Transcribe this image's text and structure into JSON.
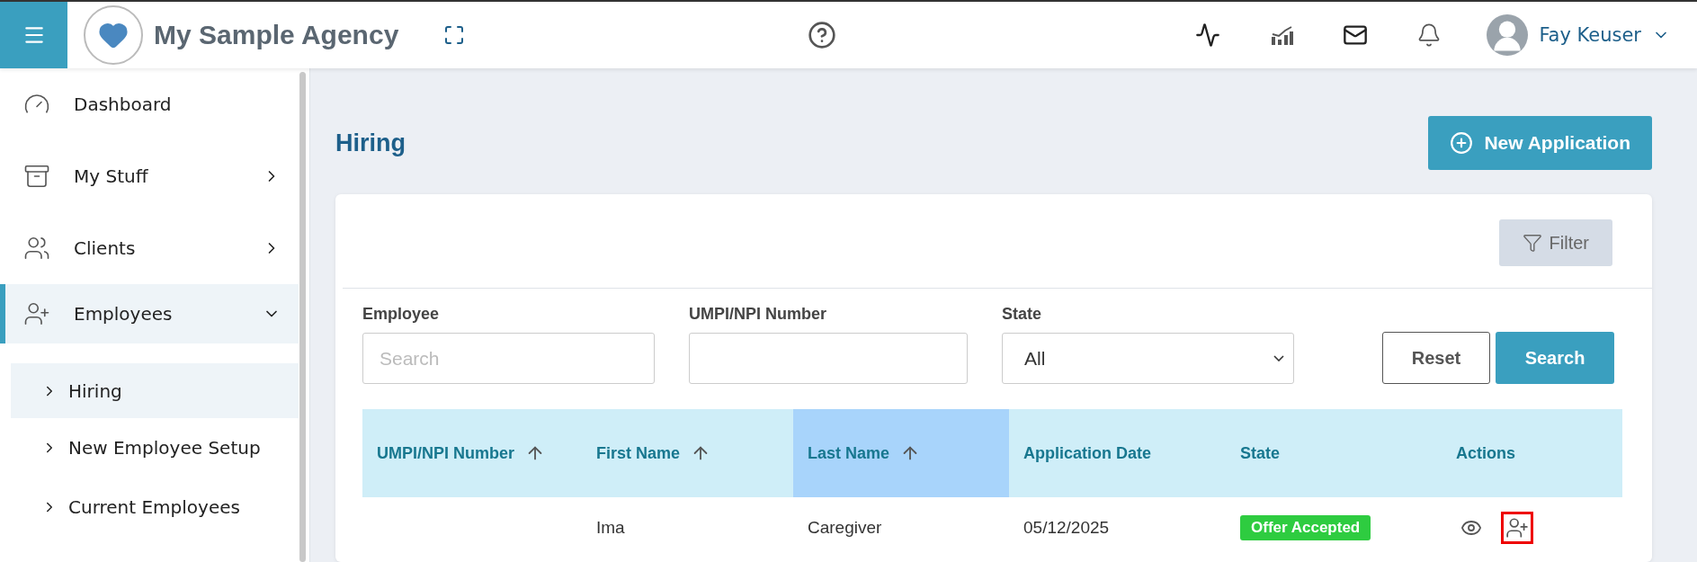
{
  "header": {
    "agency_name": "My Sample Agency",
    "user_name": "Fay Keuser"
  },
  "sidebar": {
    "items": [
      {
        "label": "Dashboard",
        "has_arrow": false,
        "selected": false
      },
      {
        "label": "My Stuff",
        "has_arrow": true,
        "expanded": false,
        "selected": false
      },
      {
        "label": "Clients",
        "has_arrow": true,
        "expanded": false,
        "selected": false
      },
      {
        "label": "Employees",
        "has_arrow": true,
        "expanded": true,
        "selected": true,
        "children": [
          {
            "label": "Hiring",
            "selected": true
          },
          {
            "label": "New Employee Setup",
            "selected": false
          },
          {
            "label": "Current Employees",
            "selected": false
          }
        ]
      }
    ]
  },
  "page": {
    "title": "Hiring",
    "new_button": "New Application"
  },
  "filter_button": "Filter",
  "search_form": {
    "fields": [
      {
        "label": "Employee",
        "kind": "text",
        "placeholder": "Search"
      },
      {
        "label": "UMPI/NPI Number",
        "kind": "text"
      },
      {
        "label": "State",
        "kind": "select",
        "value": "All"
      }
    ],
    "reset_button": "Reset",
    "search_button": "Search"
  },
  "table": {
    "columns": [
      {
        "label": "UMPI/NPI Number",
        "sortable": true,
        "selected": false
      },
      {
        "label": "First Name",
        "sortable": true,
        "selected": false
      },
      {
        "label": "Last Name",
        "sortable": true,
        "selected": true
      },
      {
        "label": "Application Date",
        "sortable": false,
        "selected": false
      },
      {
        "label": "State",
        "sortable": false,
        "selected": false
      },
      {
        "label": "Actions",
        "sortable": false,
        "selected": false
      }
    ],
    "rows": [
      {
        "first_name": "Ima",
        "last_name": "Caregiver",
        "application_date": "05/12/2025",
        "state": "Offer Accepted",
        "actions": [
          {
            "kind": "view",
            "highlighted": false
          },
          {
            "kind": "add_user",
            "highlighted": true
          }
        ]
      }
    ]
  }
}
